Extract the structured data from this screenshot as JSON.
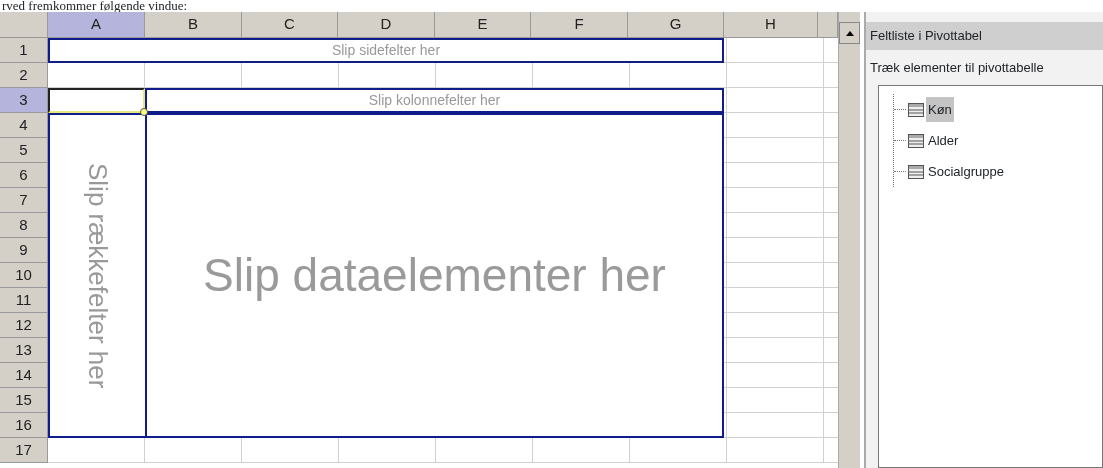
{
  "document_text": "rved fremkommer følgende vindue:",
  "sheet": {
    "columns": [
      {
        "label": "A",
        "selected": true
      },
      {
        "label": "B",
        "selected": false
      },
      {
        "label": "C",
        "selected": false
      },
      {
        "label": "D",
        "selected": false
      },
      {
        "label": "E",
        "selected": false
      },
      {
        "label": "F",
        "selected": false
      },
      {
        "label": "G",
        "selected": false
      },
      {
        "label": "H",
        "selected": false
      }
    ],
    "rows": [
      {
        "label": "1",
        "selected": false
      },
      {
        "label": "2",
        "selected": false
      },
      {
        "label": "3",
        "selected": true
      },
      {
        "label": "4",
        "selected": false
      },
      {
        "label": "5",
        "selected": false
      },
      {
        "label": "6",
        "selected": false
      },
      {
        "label": "7",
        "selected": false
      },
      {
        "label": "8",
        "selected": false
      },
      {
        "label": "9",
        "selected": false
      },
      {
        "label": "10",
        "selected": false
      },
      {
        "label": "11",
        "selected": false
      },
      {
        "label": "12",
        "selected": false
      },
      {
        "label": "13",
        "selected": false
      },
      {
        "label": "14",
        "selected": false
      },
      {
        "label": "15",
        "selected": false
      },
      {
        "label": "16",
        "selected": false
      },
      {
        "label": "17",
        "selected": false
      }
    ],
    "drop_zones": [
      {
        "kind": "page",
        "text": "Slip sidefelter her"
      },
      {
        "kind": "column",
        "text": "Slip kolonnefelter her"
      },
      {
        "kind": "row",
        "text": "Slip rækkefelter her"
      },
      {
        "kind": "data",
        "text": "Slip dataelementer her"
      }
    ]
  },
  "field_list": {
    "title": "Feltliste i Pivottabel",
    "instruction": "Træk elementer til pivottabelle",
    "fields": [
      {
        "label": "Køn",
        "selected": true
      },
      {
        "label": "Alder",
        "selected": false
      },
      {
        "label": "Socialgruppe",
        "selected": false
      }
    ]
  }
}
